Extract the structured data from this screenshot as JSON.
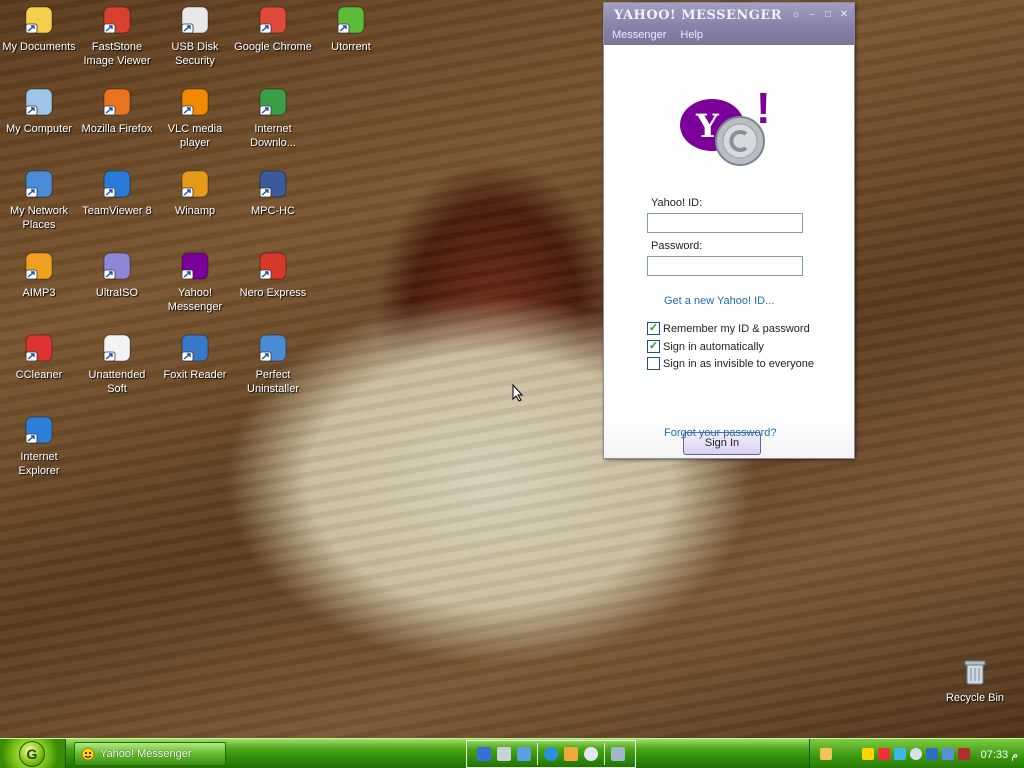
{
  "desktop": {
    "icons": [
      {
        "label": "My Documents",
        "icon": "my-documents-icon"
      },
      {
        "label": "FastStone Image Viewer",
        "icon": "faststone-icon"
      },
      {
        "label": "USB Disk Security",
        "icon": "usb-disk-security-icon"
      },
      {
        "label": "Google Chrome",
        "icon": "chrome-icon"
      },
      {
        "label": "Utorrent",
        "icon": "utorrent-icon"
      },
      {
        "label": "My Computer",
        "icon": "my-computer-icon"
      },
      {
        "label": "Mozilla Firefox",
        "icon": "firefox-icon"
      },
      {
        "label": "VLC media player",
        "icon": "vlc-icon"
      },
      {
        "label": "Internet Downlo...",
        "icon": "idm-icon"
      },
      {
        "label": "My Network Places",
        "icon": "network-places-icon"
      },
      {
        "label": "TeamViewer 8",
        "icon": "teamviewer-icon"
      },
      {
        "label": "Winamp",
        "icon": "winamp-icon"
      },
      {
        "label": "MPC-HC",
        "icon": "mpc-hc-icon"
      },
      {
        "label": "AIMP3",
        "icon": "aimp-icon"
      },
      {
        "label": "UltraISO",
        "icon": "ultraiso-icon"
      },
      {
        "label": "Yahoo! Messenger",
        "icon": "yahoo-messenger-icon"
      },
      {
        "label": "Nero Express",
        "icon": "nero-icon"
      },
      {
        "label": "CCleaner",
        "icon": "ccleaner-icon"
      },
      {
        "label": "Unattended Soft",
        "icon": "document-icon"
      },
      {
        "label": "Foxit Reader",
        "icon": "foxit-icon"
      },
      {
        "label": "Perfect Uninstaller",
        "icon": "uninstaller-icon"
      },
      {
        "label": "Internet Explorer",
        "icon": "ie-icon"
      }
    ],
    "recycle_bin": "Recycle Bin"
  },
  "messenger": {
    "title": "YAHOO! MESSENGER",
    "menu": [
      "Messenger",
      "Help"
    ],
    "yahoo_id_label": "Yahoo! ID:",
    "yahoo_id_value": "",
    "password_label": "Password:",
    "password_value": "",
    "get_new_id": "Get a new Yahoo! ID...",
    "options": [
      {
        "label": "Remember my ID & password",
        "checked": true
      },
      {
        "label": "Sign in automatically",
        "checked": true
      },
      {
        "label": "Sign in as invisible to everyone",
        "checked": false
      }
    ],
    "sign_in_label": "Sign In",
    "forgot_password": "Forgot your password?",
    "brand_color": "#7b0099"
  },
  "taskbar": {
    "task_label": "Yahoo! Messenger",
    "clock": "07:33 م"
  }
}
